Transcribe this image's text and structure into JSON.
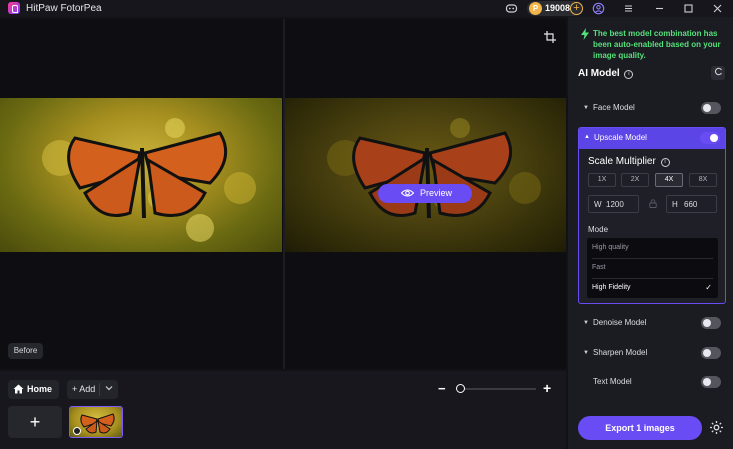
{
  "app": {
    "title": "HitPaw FotorPea"
  },
  "titlebar": {
    "coin_count": "19008"
  },
  "canvas": {
    "before_label": "Before",
    "preview_label": "Preview"
  },
  "bottombar": {
    "home_label": "Home",
    "add_label": "+ Add",
    "add_image_symbol": "+",
    "zoom_value": 0.05
  },
  "panel": {
    "notice": "The best model combination has been auto-enabled based on your image quality.",
    "ai_model_title": "AI Model",
    "models": [
      {
        "label": "Face Model",
        "enabled": false
      },
      {
        "label": "Upscale Model",
        "enabled": true
      },
      {
        "label": "Denoise Model",
        "enabled": false
      },
      {
        "label": "Sharpen Model",
        "enabled": false
      },
      {
        "label": "Text Model",
        "enabled": false
      }
    ],
    "upscale": {
      "scale_title": "Scale Multiplier",
      "multipliers": [
        "1X",
        "2X",
        "4X",
        "8X"
      ],
      "selected_multiplier": "4X",
      "width_key": "W",
      "width": "1200",
      "height_key": "H",
      "height": "660",
      "mode_label": "Mode",
      "modes": [
        "High quality",
        "Fast",
        "High Fidelity"
      ],
      "selected_mode": "High Fidelity"
    },
    "export_label": "Export 1 images"
  },
  "colors": {
    "accent": "#6a4cf5",
    "notice": "#56e07a",
    "coin": "#f1b54a"
  }
}
